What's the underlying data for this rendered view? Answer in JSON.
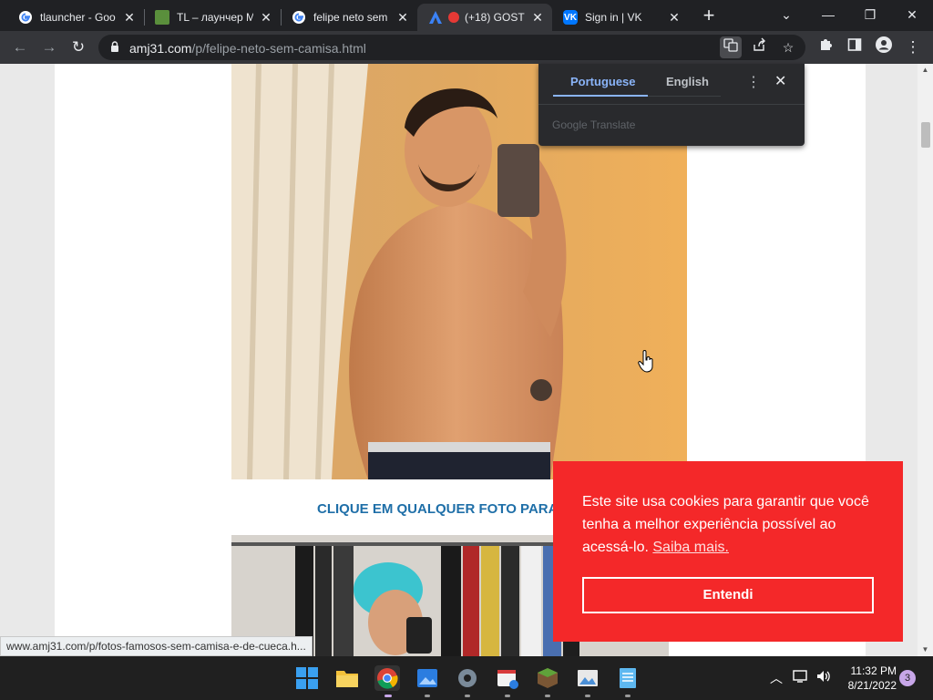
{
  "tabs": [
    {
      "title": "tlauncher - Goo",
      "favicon": "google-icon",
      "color": "#ffffff"
    },
    {
      "title": "TL – лаунчер M",
      "favicon": "tlauncher-icon",
      "color": "#5a8f3c"
    },
    {
      "title": "felipe neto sem",
      "favicon": "google-icon",
      "color": "#ffffff"
    },
    {
      "title": "(+18) GOST",
      "favicon": "adult-icon",
      "color": "#e53935"
    },
    {
      "title": "Sign in | VK",
      "favicon": "vk-icon",
      "color": "#0077ff"
    }
  ],
  "window_controls": {
    "dropdown": "⌄",
    "minimize": "—",
    "restore": "❐",
    "close": "✕"
  },
  "toolbar": {
    "back": "←",
    "forward": "→",
    "reload": "↻"
  },
  "address": {
    "domain": "amj31.com",
    "path": "/p/felipe-neto-sem-camisa.html"
  },
  "translate": {
    "lang_source": "Portuguese",
    "lang_target": "English",
    "brand": "Google Translate"
  },
  "page": {
    "caption": "CLIQUE EM QUALQUER FOTO PARA VE"
  },
  "cookie": {
    "message": "Este site usa cookies para garantir que você tenha a melhor experiência possível ao acessá-lo.",
    "link": "Saiba mais.",
    "button": "Entendi"
  },
  "status_url": "www.amj31.com/p/fotos-famosos-sem-camisa-e-de-cueca.h...",
  "taskbar": {
    "time": "11:32 PM",
    "date": "8/21/2022",
    "notifications": "3"
  },
  "colors": {
    "accent_blue": "#8ab4f8",
    "cookie_red": "#f42829",
    "caption_blue": "#1f6fa8"
  }
}
